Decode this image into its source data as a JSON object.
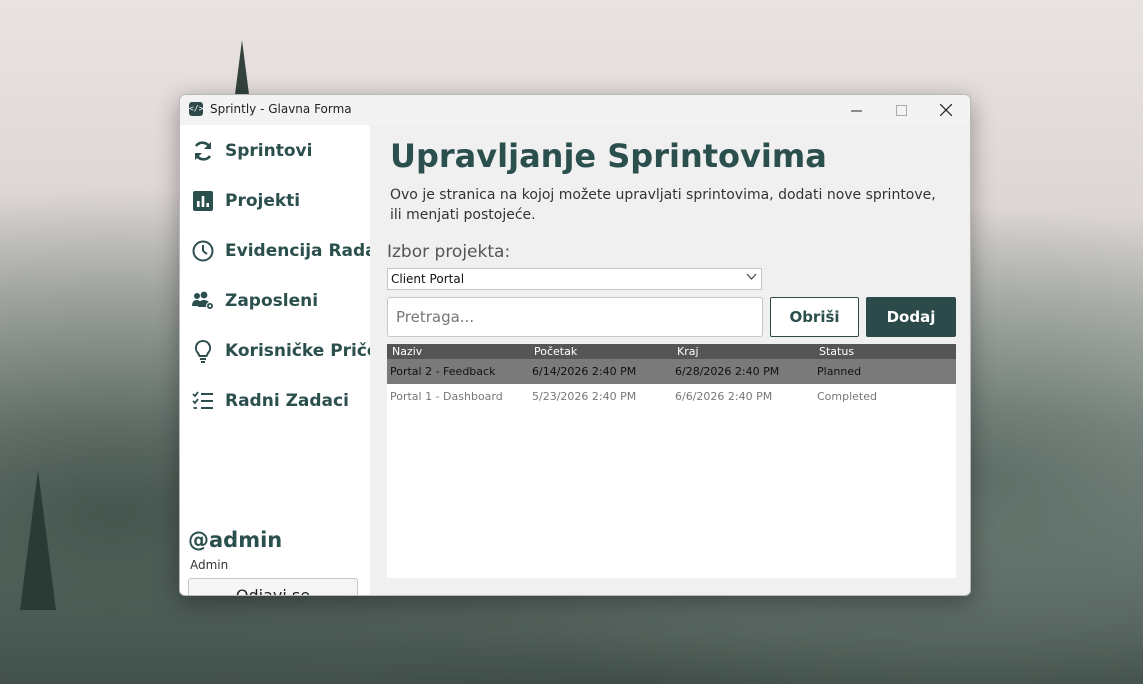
{
  "window": {
    "title": "Sprintly - Glavna Forma",
    "app_icon": "</>",
    "controls": {
      "minimize": "—",
      "maximize": "☐",
      "close": "✕"
    }
  },
  "sidebar": {
    "items": [
      {
        "label": "Sprintovi",
        "icon": "refresh-icon"
      },
      {
        "label": "Projekti",
        "icon": "bar-chart-icon"
      },
      {
        "label": "Evidencija Rada",
        "icon": "clock-icon"
      },
      {
        "label": "Zaposleni",
        "icon": "users-icon"
      },
      {
        "label": "Korisničke Priče",
        "icon": "lightbulb-icon"
      },
      {
        "label": "Radni Zadaci",
        "icon": "checklist-icon"
      }
    ],
    "user": {
      "handle": "@admin",
      "role": "Admin"
    },
    "logout_label": "Odjavi se"
  },
  "main": {
    "title": "Upravljanje Sprintovima",
    "description": "Ovo je stranica na kojoj možete upravljati sprintovima, dodati nove sprintove, ili menjati postojeće.",
    "project_label": "Izbor projekta:",
    "project_selected": "Client Portal",
    "search_placeholder": "Pretraga...",
    "delete_label": "Obriši",
    "add_label": "Dodaj",
    "table": {
      "columns": [
        "Naziv",
        "Početak",
        "Kraj",
        "Status"
      ],
      "rows": [
        [
          "Portal 2 - Feedback",
          "6/14/2026 2:40 PM",
          "6/28/2026 2:40 PM",
          "Planned"
        ],
        [
          "Portal 1 - Dashboard",
          "5/23/2026 2:40 PM",
          "6/6/2026 2:40 PM",
          "Completed"
        ]
      ],
      "selected_row": 0
    }
  },
  "colors": {
    "accent": "#2d4a4a",
    "text_accent": "#2b4f4d"
  }
}
